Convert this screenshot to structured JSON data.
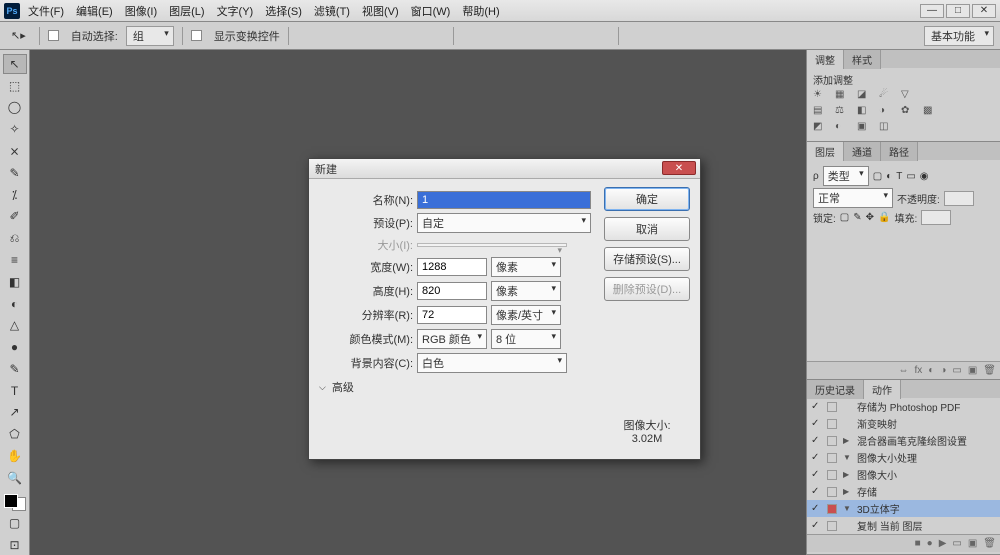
{
  "menu": {
    "items": [
      "文件(F)",
      "编辑(E)",
      "图像(I)",
      "图层(L)",
      "文字(Y)",
      "选择(S)",
      "滤镜(T)",
      "视图(V)",
      "窗口(W)",
      "帮助(H)"
    ]
  },
  "winctrl": {
    "min": "—",
    "max": "□",
    "close": "✕"
  },
  "options": {
    "autoselect": "自动选择:",
    "group": "组",
    "showtransform": "显示变换控件",
    "essentials": "基本功能"
  },
  "toolbox": [
    "↖",
    "⬚",
    "◯",
    "✧",
    "⨯",
    "✎",
    "⁒",
    "✐",
    "⎌",
    "≡",
    "◧",
    "◐",
    "△",
    "●",
    "✎",
    "⌫",
    "T",
    "↗",
    "⬠",
    "✋",
    "🔍"
  ],
  "panels": {
    "adjust_tab": "调整",
    "styles_tab": "样式",
    "add_adjust": "添加调整",
    "layers_tab": "图层",
    "channels_tab": "通道",
    "paths_tab": "路径",
    "kind": "类型",
    "blend": "正常",
    "opacity_lab": "不透明度:",
    "lock_lab": "锁定:",
    "fill_lab": "填充:",
    "history_tab": "历史记录",
    "actions_tab": "动作",
    "actions": [
      {
        "chk": "✓",
        "tri": "",
        "txt": "存储为 Photoshop PDF"
      },
      {
        "chk": "✓",
        "tri": "",
        "txt": "渐变映射"
      },
      {
        "chk": "✓",
        "tri": "▶",
        "txt": "混合器画笔克隆绘图设置"
      },
      {
        "chk": "✓",
        "tri": "▼",
        "txt": "图像大小处理"
      },
      {
        "chk": "✓",
        "tri": "▶",
        "txt": "图像大小"
      },
      {
        "chk": "✓",
        "tri": "▶",
        "txt": "存储"
      },
      {
        "chk": "✓",
        "tri": "▼",
        "txt": "3D立体字",
        "sel": true,
        "box": true
      },
      {
        "chk": "✓",
        "tri": "",
        "txt": "复制 当前 图层"
      }
    ]
  },
  "dialog": {
    "title": "新建",
    "name_lab": "名称(N):",
    "name_val": "1",
    "preset_lab": "预设(P):",
    "preset_val": "自定",
    "size_lab": "大小(I):",
    "width_lab": "宽度(W):",
    "width_val": "1288",
    "height_lab": "高度(H):",
    "height_val": "820",
    "res_lab": "分辨率(R):",
    "res_val": "72",
    "mode_lab": "颜色模式(M):",
    "mode_val": "RGB 颜色",
    "bit_val": "8 位",
    "bg_lab": "背景内容(C):",
    "bg_val": "白色",
    "unit_px": "像素",
    "unit_ppi": "像素/英寸",
    "advanced": "高级",
    "ok": "确定",
    "cancel": "取消",
    "savepreset": "存储预设(S)...",
    "delpreset": "删除预设(D)...",
    "imgsize_lab": "图像大小:",
    "imgsize_val": "3.02M"
  }
}
